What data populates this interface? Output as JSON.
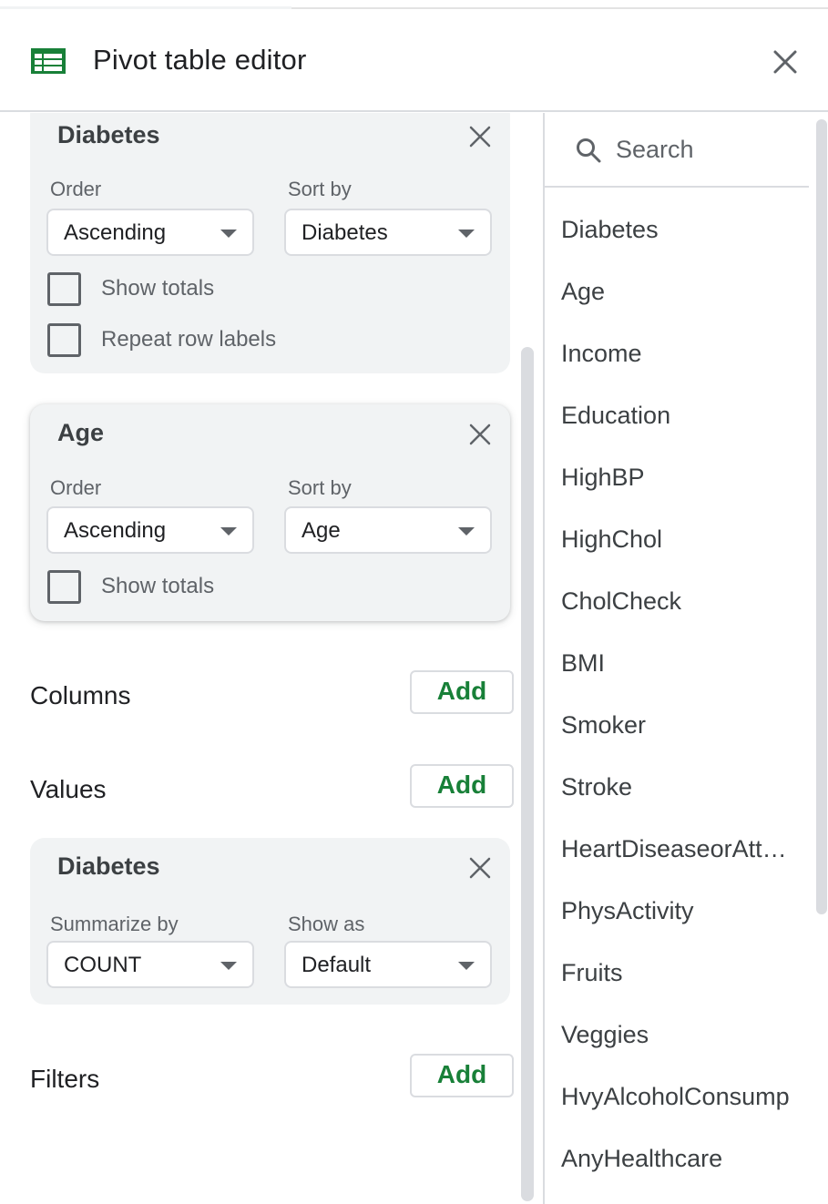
{
  "header": {
    "title": "Pivot table editor"
  },
  "rows_section": {
    "cards": [
      {
        "title": "Diabetes",
        "order_label": "Order",
        "order_value": "Ascending",
        "sortby_label": "Sort by",
        "sortby_value": "Diabetes",
        "show_totals_label": "Show totals",
        "repeat_row_labels_label": "Repeat row labels"
      },
      {
        "title": "Age",
        "order_label": "Order",
        "order_value": "Ascending",
        "sortby_label": "Sort by",
        "sortby_value": "Age",
        "show_totals_label": "Show totals"
      }
    ]
  },
  "columns": {
    "label": "Columns",
    "add_label": "Add"
  },
  "values": {
    "label": "Values",
    "add_label": "Add",
    "card": {
      "title": "Diabetes",
      "summarize_label": "Summarize by",
      "summarize_value": "COUNT",
      "showas_label": "Show as",
      "showas_value": "Default"
    }
  },
  "filters": {
    "label": "Filters",
    "add_label": "Add"
  },
  "search": {
    "placeholder": "Search"
  },
  "fields": [
    "Diabetes",
    "Age",
    "Income",
    "Education",
    "HighBP",
    "HighChol",
    "CholCheck",
    "BMI",
    "Smoker",
    "Stroke",
    "HeartDiseaseorAttack",
    "PhysActivity",
    "Fruits",
    "Veggies",
    "HvyAlcoholConsump",
    "AnyHealthcare"
  ],
  "colors": {
    "accent_green": "#188038",
    "card_bg": "#f1f3f4",
    "border": "#dadce0"
  }
}
